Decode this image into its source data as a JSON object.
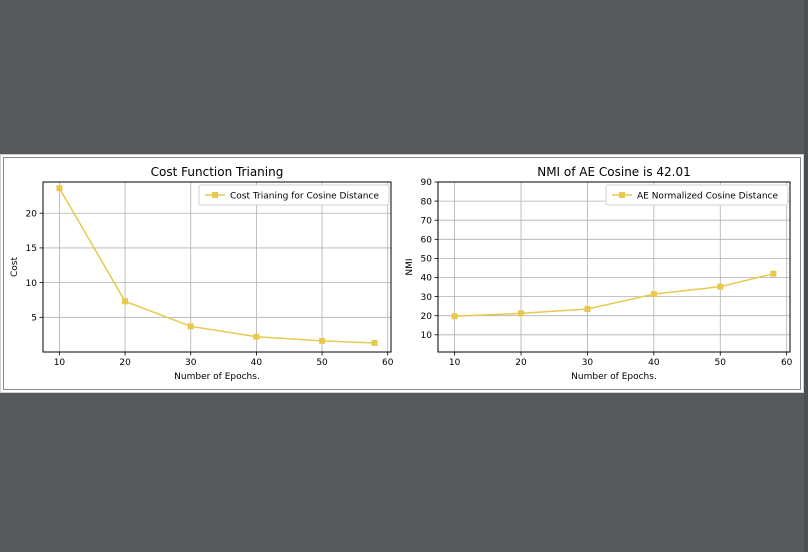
{
  "colors": {
    "background": "#55595c",
    "series": "#e8c94e",
    "grid": "#b0b0b0"
  },
  "chart_data": [
    {
      "type": "line",
      "title": "Cost Function Trianing",
      "xlabel": "Number of Epochs.",
      "ylabel": "Cost",
      "x_ticks": [
        10,
        20,
        30,
        40,
        50,
        60
      ],
      "y_ticks": [
        5,
        10,
        15,
        20
      ],
      "xlim": [
        7.5,
        60.5
      ],
      "ylim": [
        0,
        24.5
      ],
      "grid": true,
      "legend_position": "top-right",
      "series": [
        {
          "name": "Cost Trianing for Cosine Distance",
          "x": [
            10,
            20,
            30,
            40,
            50,
            58
          ],
          "y": [
            23.6,
            7.3,
            3.7,
            2.2,
            1.6,
            1.3
          ],
          "marker": "square"
        }
      ]
    },
    {
      "type": "line",
      "title": "NMI of AE Cosine is 42.01",
      "xlabel": "Number of Epochs.",
      "ylabel": "NMI",
      "x_ticks": [
        10,
        20,
        30,
        40,
        50,
        60
      ],
      "y_ticks": [
        10,
        20,
        30,
        40,
        50,
        60,
        70,
        80,
        90
      ],
      "xlim": [
        7.5,
        60.5
      ],
      "ylim": [
        1,
        90
      ],
      "grid": true,
      "legend_position": "top-right",
      "series": [
        {
          "name": "AE Normalized Cosine Distance",
          "x": [
            10,
            20,
            30,
            40,
            50,
            58
          ],
          "y": [
            19.7,
            21.2,
            23.5,
            31.3,
            35.2,
            42.0
          ],
          "marker": "square"
        }
      ]
    }
  ]
}
